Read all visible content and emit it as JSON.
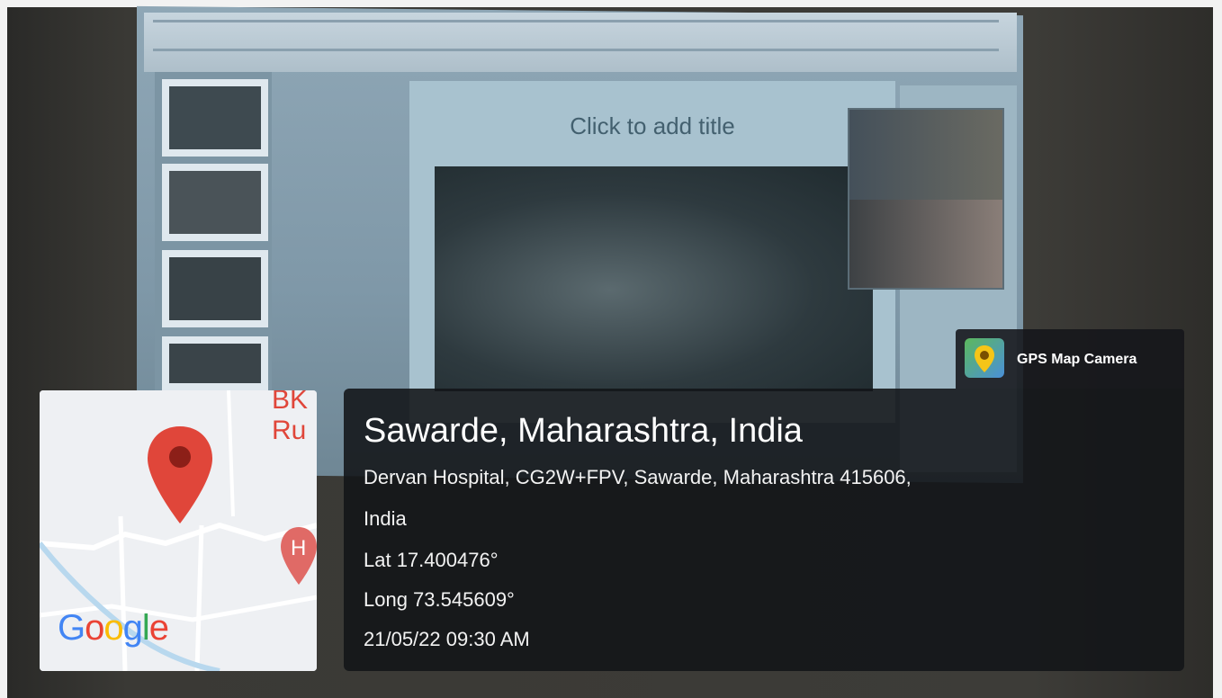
{
  "slide": {
    "title_placeholder": "Click to add title"
  },
  "map": {
    "place_label": "BK\nRu",
    "provider": "Google",
    "pin_color": "#e0463a",
    "marker_letter": "H"
  },
  "badge": {
    "app_name": "GPS Map Camera",
    "icon": "gps-map-camera-icon"
  },
  "location": {
    "title": "Sawarde, Maharashtra, India",
    "address_line1": "Dervan Hospital, CG2W+FPV, Sawarde, Maharashtra 415606,",
    "address_line2": "India",
    "latitude": "Lat 17.400476°",
    "longitude": "Long 73.545609°",
    "datetime": "21/05/22 09:30 AM"
  }
}
